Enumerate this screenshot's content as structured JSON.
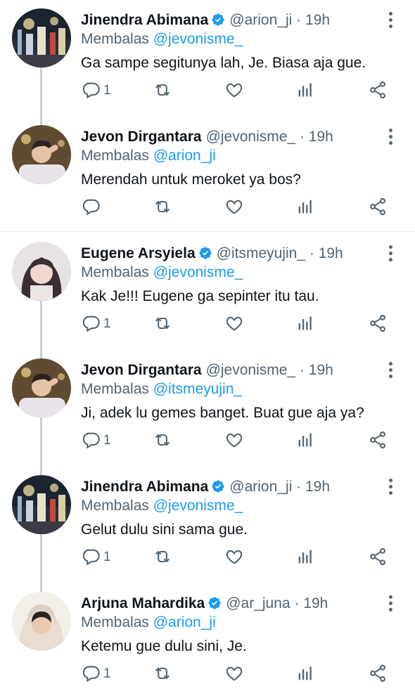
{
  "tweets": [
    {
      "name": "Jinendra Abimana",
      "verified": true,
      "handle": "@arion_ji",
      "dot": "·",
      "time": "19h",
      "replying_prefix": "Membalas",
      "replying_to": "@jevonisme_",
      "text": "Ga sampe segitunya lah, Je. Biasa aja gue.",
      "reply_count": "1",
      "avatar": "night-city-avatar"
    },
    {
      "name": "Jevon Dirgantara",
      "verified": false,
      "handle": "@jevonisme_",
      "dot": "·",
      "time": "19h",
      "replying_prefix": "Membalas",
      "replying_to": "@arion_ji",
      "text": "Merendah untuk meroket ya bos?",
      "reply_count": "",
      "avatar": "boy-avatar"
    },
    {
      "name": "Eugene Arsyiela",
      "verified": true,
      "handle": "@itsmeyujin_",
      "dot": "·",
      "time": "19h",
      "replying_prefix": "Membalas",
      "replying_to": "@jevonisme_",
      "text": "Kak Je!!! Eugene ga sepinter itu tau.",
      "reply_count": "1",
      "avatar": "girl-avatar"
    },
    {
      "name": "Jevon Dirgantara",
      "verified": false,
      "handle": "@jevonisme_",
      "dot": "·",
      "time": "19h",
      "replying_prefix": "Membalas",
      "replying_to": "@itsmeyujin_",
      "text": "Ji, adek lu gemes banget. Buat gue aja ya?",
      "reply_count": "1",
      "avatar": "boy-avatar"
    },
    {
      "name": "Jinendra Abimana",
      "verified": true,
      "handle": "@arion_ji",
      "dot": "·",
      "time": "19h",
      "replying_prefix": "Membalas",
      "replying_to": "@jevonisme_",
      "text": "Gelut dulu sini sama gue.",
      "reply_count": "1",
      "avatar": "night-city-avatar"
    },
    {
      "name": "Arjuna Mahardika",
      "verified": true,
      "handle": "@ar_juna",
      "dot": "·",
      "time": "19h",
      "replying_prefix": "Membalas",
      "replying_to": "@arion_ji",
      "text": "Ketemu gue dulu sini, Je.",
      "reply_count": "1",
      "avatar": "hoodie-avatar"
    }
  ],
  "colors": {
    "accent": "#1d9bf0",
    "secondary_text": "#536471",
    "thread_line": "#c4cfd6"
  }
}
